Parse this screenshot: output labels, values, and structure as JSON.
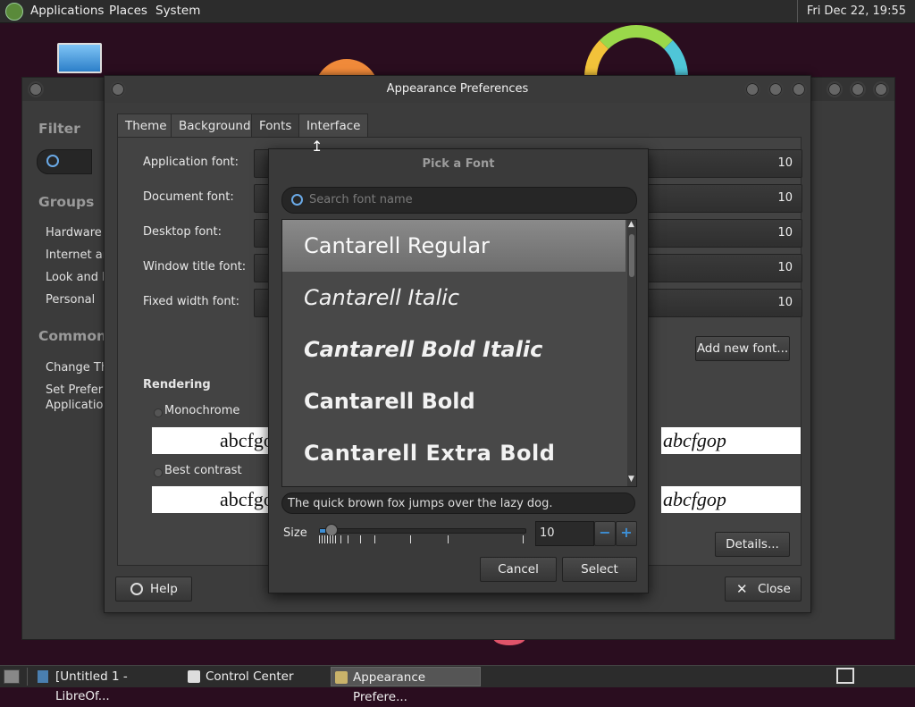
{
  "top_panel": {
    "menus": [
      "Applications",
      "Places",
      "System"
    ],
    "clock": "Fri Dec 22, 19:55"
  },
  "control_center": {
    "sidebar": {
      "filter_heading": "Filter",
      "groups_heading": "Groups",
      "groups": [
        "Hardware",
        "Internet an",
        "Look and F",
        "Personal"
      ],
      "common_heading": "Common T",
      "common_items": [
        "Change Th",
        "Set Preferre",
        "Application"
      ]
    }
  },
  "appearance": {
    "title": "Appearance Preferences",
    "tabs": [
      "Theme",
      "Background",
      "Fonts",
      "Interface"
    ],
    "active_tab": "Fonts",
    "font_rows": [
      {
        "label": "Application font:",
        "size": "10"
      },
      {
        "label": "Document font:",
        "size": "10"
      },
      {
        "label": "Desktop font:",
        "size": "10"
      },
      {
        "label": "Window title font:",
        "size": "10"
      },
      {
        "label": "Fixed width font:",
        "size": "10"
      }
    ],
    "add_new_font": "Add new font...",
    "rendering_heading": "Rendering",
    "rendering_options": [
      "Monochrome",
      "Best contrast"
    ],
    "preview_text": "abcfgop",
    "details_button": "Details...",
    "help_button": "Help",
    "close_button": "Close"
  },
  "font_dialog": {
    "title": "Pick a Font",
    "search_placeholder": "Search font name",
    "fonts": [
      "Cantarell Regular",
      "Cantarell Italic",
      "Cantarell Bold Italic",
      "Cantarell Bold",
      "Cantarell Extra Bold"
    ],
    "selected_index": 0,
    "preview_sentence": "The quick brown fox jumps over the lazy dog.",
    "size_label": "Size",
    "size_value": "10",
    "minus": "−",
    "plus": "+",
    "cancel": "Cancel",
    "select": "Select"
  },
  "taskbar": {
    "tasks": [
      "[Untitled 1 - LibreOf...",
      "Control Center",
      "Appearance Prefere..."
    ]
  },
  "colors": {
    "desktop_bg": "#2a0d1f",
    "panel_bg": "#2c2c2c",
    "window_bg": "#3c3c3c",
    "selection": "#7c7c7c",
    "accent_blue": "#3d8fd6"
  }
}
